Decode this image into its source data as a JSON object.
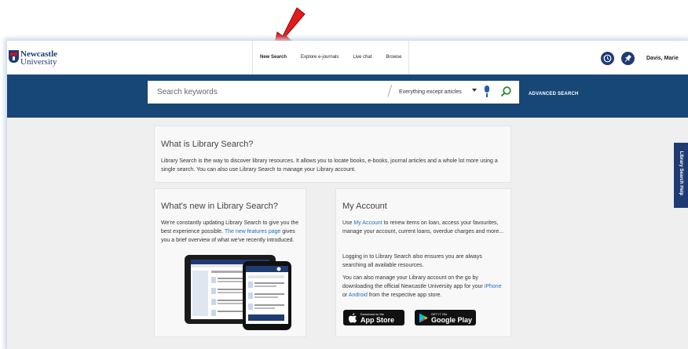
{
  "brand": {
    "line1": "Newcastle",
    "line2": "University"
  },
  "nav": [
    "New Search",
    "Explore e-journals",
    "Live chat",
    "Browse"
  ],
  "user": {
    "name": "Davis, Marie"
  },
  "search": {
    "placeholder": "Search keywords",
    "scope": "Everything except articles",
    "advanced_label": "ADVANCED SEARCH"
  },
  "help_tab": "Library Search Help",
  "cards": {
    "what_is": {
      "title": "What is Library Search?",
      "body": "Library Search is the way to discover library resources. It allows you to locate books, e-books, journal articles and a whole lot more using a single search. You can also use Library Search to manage your Library account."
    },
    "whats_new": {
      "title": "What's new in Library Search?",
      "body_before": "We're constantly updating Library Search to give you the best experience possible. ",
      "link": "The new features page",
      "body_after": " gives you a brief overview of what we've recently introduced."
    },
    "account": {
      "title": "My Account",
      "p1_before": "Use ",
      "p1_link": "My Account",
      "p1_after": " to renew items on loan, access your favourites, manage your account, current loans, overdue charges and more...",
      "p2": "Logging in to Library Search also ensures you are always searching all available resources.",
      "p3_before": "You can also manage your Library account on the go by downloading the official Newcastle University app for your ",
      "p3_link1": "iPhone",
      "p3_mid": " or ",
      "p3_link2": "Android",
      "p3_after": " from the respective app store."
    }
  },
  "badges": {
    "appstore": {
      "small": "Download on the",
      "big": "App Store"
    },
    "googleplay": {
      "small": "GET IT ON",
      "big": "Google Play"
    }
  },
  "colors": {
    "brand_blue": "#1f3b73",
    "search_band": "#174777",
    "arrow_red": "#e51b1b"
  }
}
